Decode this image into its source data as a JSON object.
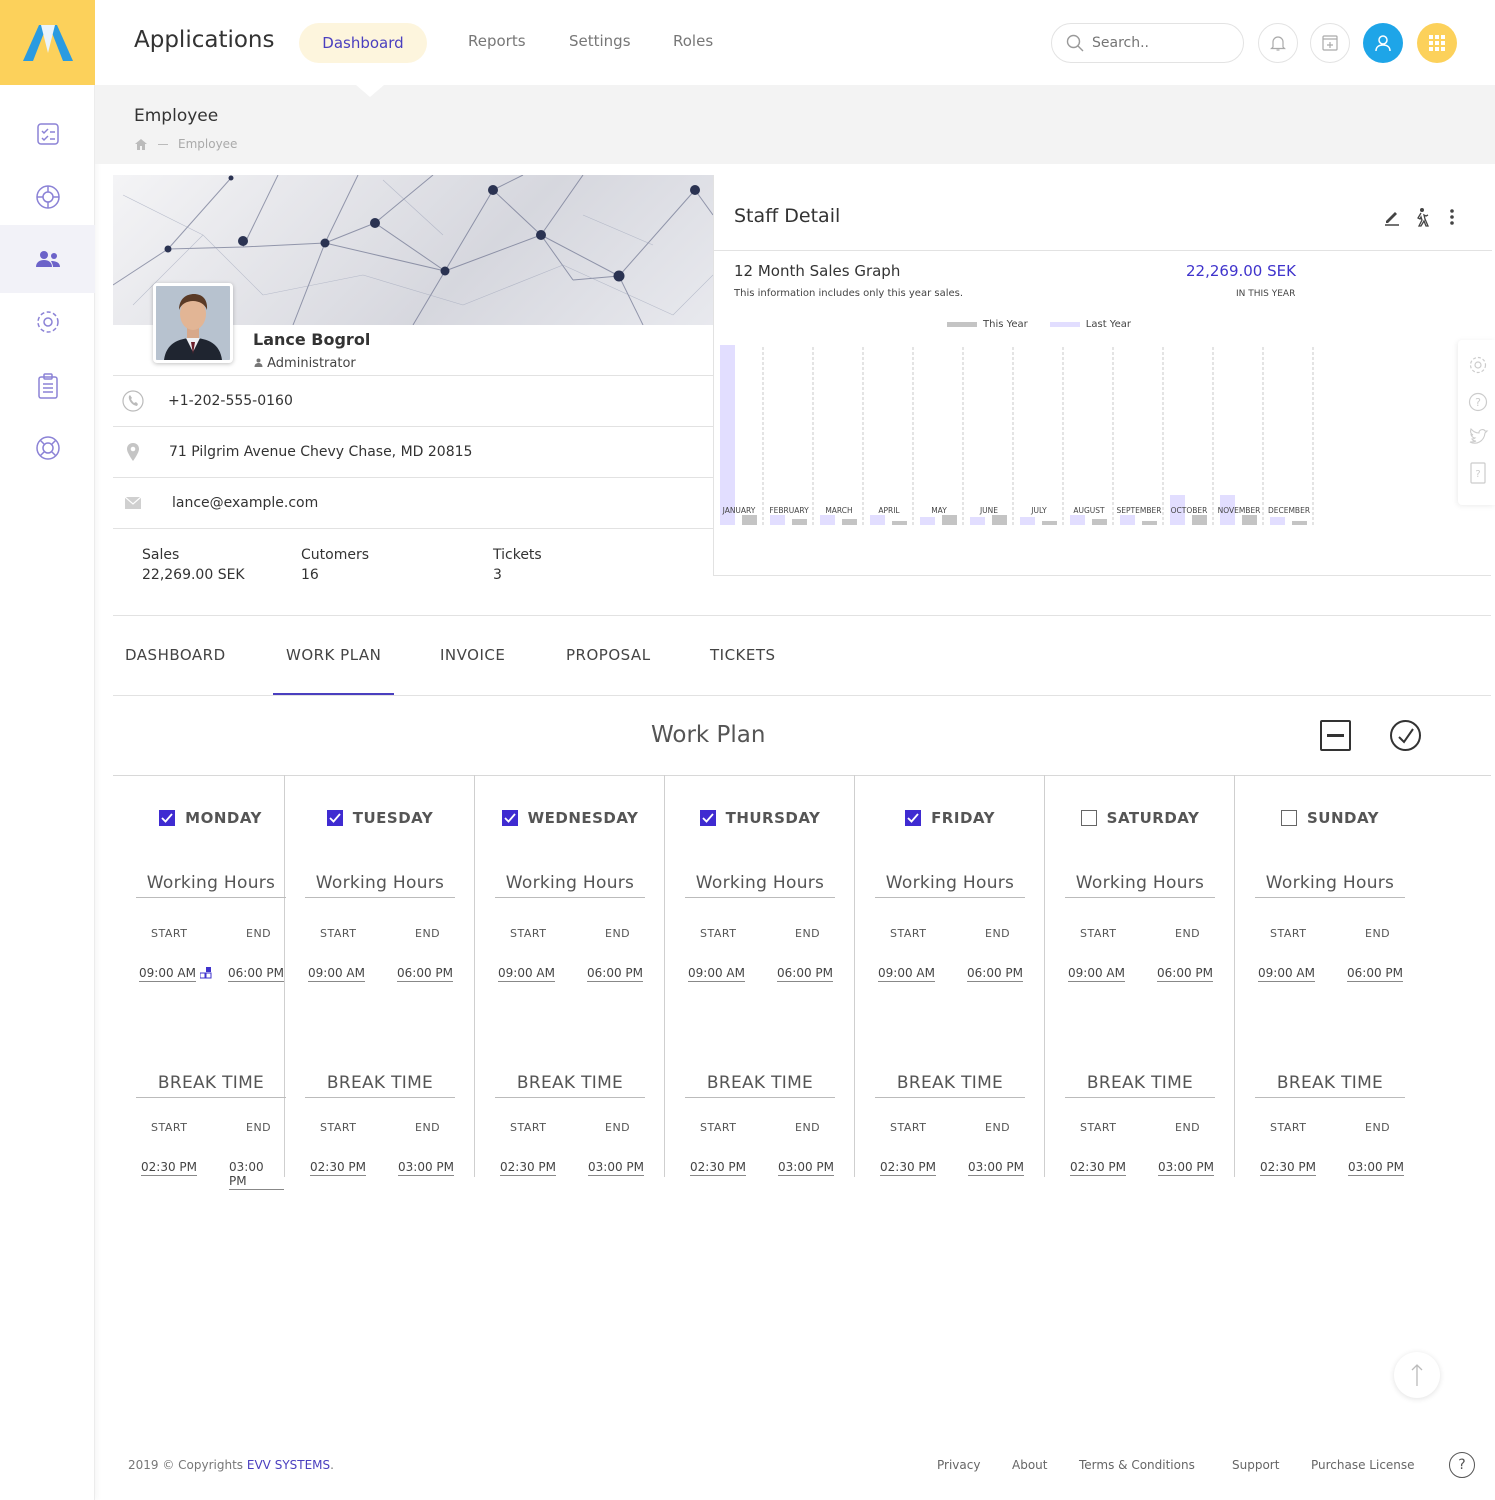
{
  "header": {
    "app_title": "Applications",
    "nav": [
      "Dashboard",
      "Reports",
      "Settings",
      "Roles"
    ],
    "search_placeholder": "Search.."
  },
  "subheader": {
    "page_title": "Employee",
    "breadcrumb": "Employee"
  },
  "profile": {
    "name": "Lance Bogrol",
    "role": "Administrator",
    "phone": "+1-202-555-0160",
    "address": "71 Pilgrim Avenue Chevy Chase, MD 20815",
    "email": "lance@example.com",
    "stats": [
      {
        "label": "Sales",
        "value": "22,269.00 SEK"
      },
      {
        "label": "Cutomers",
        "value": "16"
      },
      {
        "label": "Tickets",
        "value": "3"
      }
    ]
  },
  "staff_detail": {
    "title": "Staff Detail",
    "graph_title": "12 Month Sales Graph",
    "graph_subtitle": "This information includes only this year sales.",
    "total": "22,269.00 SEK",
    "total_label": "IN THIS YEAR"
  },
  "chart_data": {
    "type": "bar",
    "categories": [
      "JANUARY",
      "FEBRUARY",
      "MARCH",
      "APRIL",
      "MAY",
      "JUNE",
      "JULY",
      "AUGUST",
      "SEPTEMBER",
      "OCTOBER",
      "NOVEMBER",
      "DECEMBER"
    ],
    "series": [
      {
        "name": "This Year",
        "color": "#c4c4c4",
        "values": [
          10,
          6,
          6,
          4,
          10,
          10,
          4,
          6,
          4,
          10,
          10,
          4
        ]
      },
      {
        "name": "Last Year",
        "color": "#e2deff",
        "values": [
          180,
          10,
          10,
          10,
          8,
          8,
          8,
          10,
          10,
          30,
          30,
          8
        ]
      }
    ],
    "legend": "top"
  },
  "tabs": [
    "DASHBOARD",
    "WORK PLAN",
    "INVOICE",
    "PROPOSAL",
    "TICKETS"
  ],
  "work_plan": {
    "title": "Work Plan",
    "working_hours_label": "Working Hours",
    "break_label": "BREAK TIME",
    "start_label": "START",
    "end_label": "END",
    "days": [
      {
        "name": "MONDAY",
        "checked": true,
        "work_start": "09:00 AM",
        "work_end": "06:00 PM",
        "break_start": "02:30 PM",
        "break_end": "03:00 PM"
      },
      {
        "name": "TUESDAY",
        "checked": true,
        "work_start": "09:00 AM",
        "work_end": "06:00 PM",
        "break_start": "02:30 PM",
        "break_end": "03:00 PM"
      },
      {
        "name": "WEDNESDAY",
        "checked": true,
        "work_start": "09:00 AM",
        "work_end": "06:00 PM",
        "break_start": "02:30 PM",
        "break_end": "03:00 PM"
      },
      {
        "name": "THURSDAY",
        "checked": true,
        "work_start": "09:00 AM",
        "work_end": "06:00 PM",
        "break_start": "02:30 PM",
        "break_end": "03:00 PM"
      },
      {
        "name": "FRIDAY",
        "checked": true,
        "work_start": "09:00 AM",
        "work_end": "06:00 PM",
        "break_start": "02:30 PM",
        "break_end": "03:00 PM"
      },
      {
        "name": "SATURDAY",
        "checked": false,
        "work_start": "09:00 AM",
        "work_end": "06:00 PM",
        "break_start": "02:30 PM",
        "break_end": "03:00 PM"
      },
      {
        "name": "SUNDAY",
        "checked": false,
        "work_start": "09:00 AM",
        "work_end": "06:00 PM",
        "break_start": "02:30 PM",
        "break_end": "03:00 PM"
      }
    ]
  },
  "footer": {
    "copyright": "2019 © Copyrights",
    "brand": "EVV SYSTEMS",
    "links": [
      "Privacy",
      "About",
      "Terms & Conditions",
      "Support",
      "Purchase License"
    ],
    "help": "?"
  },
  "colors": {
    "accent": "#4a3fbf",
    "brand_yellow": "#fcd15b",
    "user_blue": "#1ea5e8"
  }
}
